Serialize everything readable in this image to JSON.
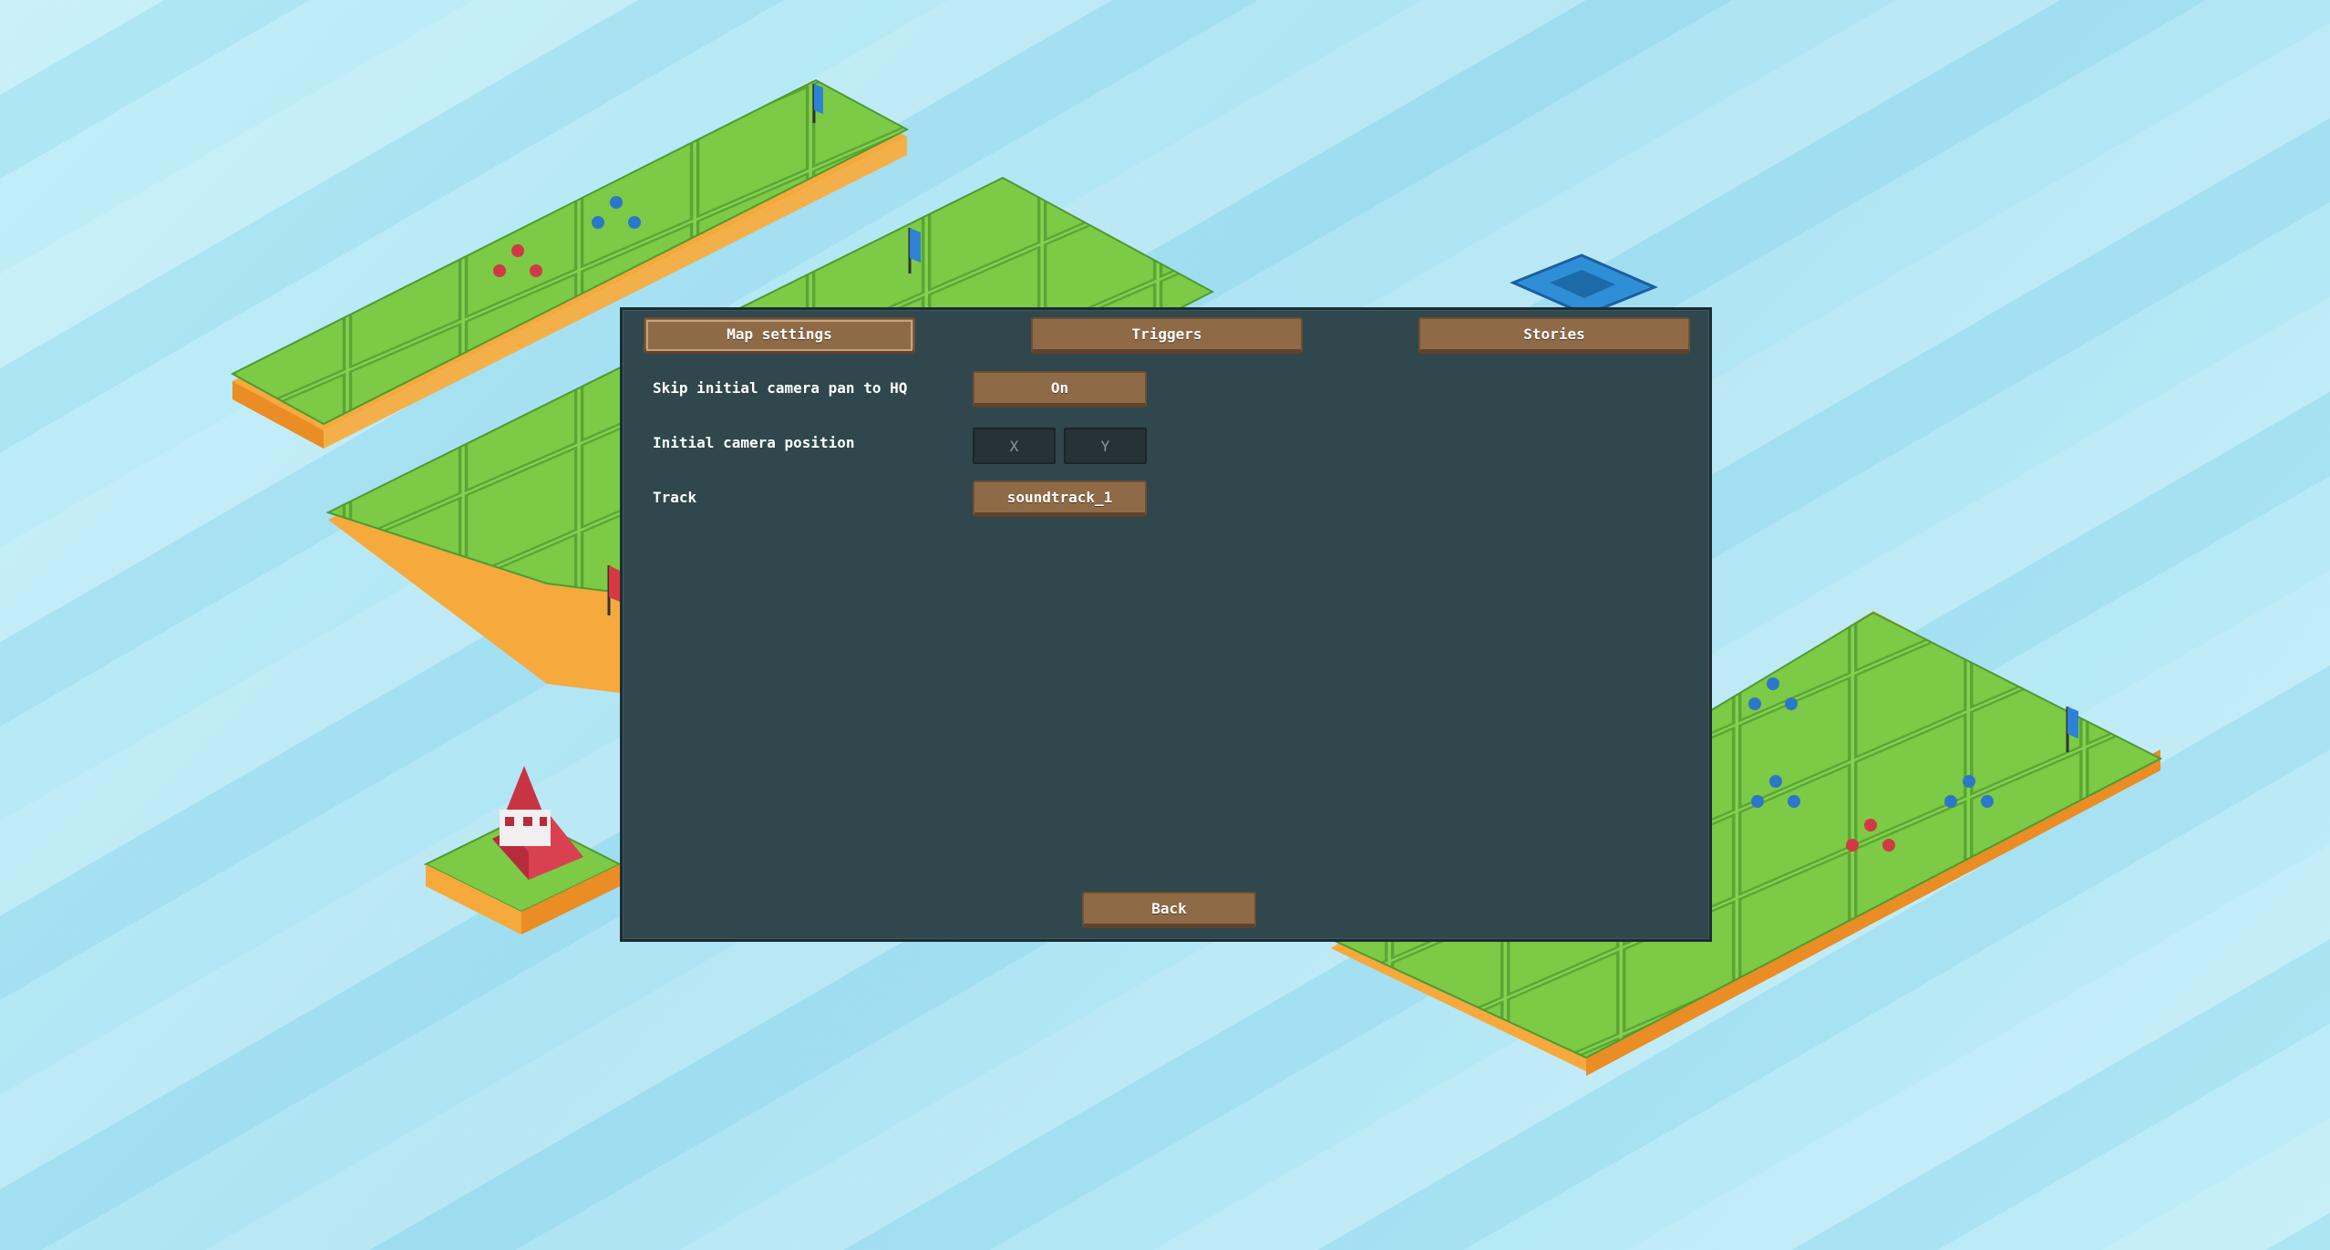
{
  "tabs": {
    "map_settings": "Map settings",
    "triggers": "Triggers",
    "stories": "Stories"
  },
  "settings": {
    "skip_pan_label": "Skip initial camera pan to HQ",
    "skip_pan_value": "On",
    "camera_label": "Initial camera position",
    "camera_x_placeholder": "X",
    "camera_y_placeholder": "Y",
    "track_label": "Track",
    "track_value": "soundtrack_1"
  },
  "footer": {
    "back_label": "Back"
  },
  "colors": {
    "dialog_bg": "#2f474d",
    "button": "#8f6a47",
    "water": "#aee6f3",
    "grass": "#7fd04a",
    "cliff": "#f5a93a"
  },
  "icons": {
    "blue_team_flag": "blue-flag-icon",
    "red_team_flag": "red-flag-icon",
    "hq_building": "hq-building-icon"
  }
}
